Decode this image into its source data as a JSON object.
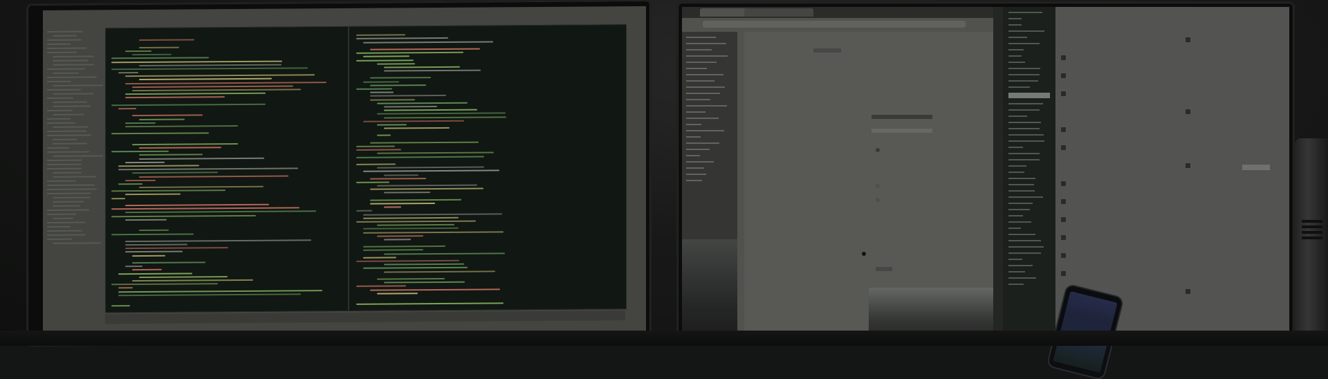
{
  "scene": {
    "subject": "dual-monitor-desk-setup",
    "monitor_left": {
      "content": "code-editor",
      "theme_color": "#131a14",
      "syntax_colors": [
        "#6fa86a",
        "#8fbf6a",
        "#c9c27a",
        "#9a9d95",
        "#d47a6a"
      ]
    },
    "monitor_right": {
      "content": [
        "browser",
        "app-sidebar",
        "notes-panel"
      ]
    },
    "phone": {
      "screen_color": "#222842"
    },
    "colors": {
      "wall": "#1a1b1a",
      "bezel": "#0d0e0d",
      "desk": "#0e0f0e"
    }
  }
}
